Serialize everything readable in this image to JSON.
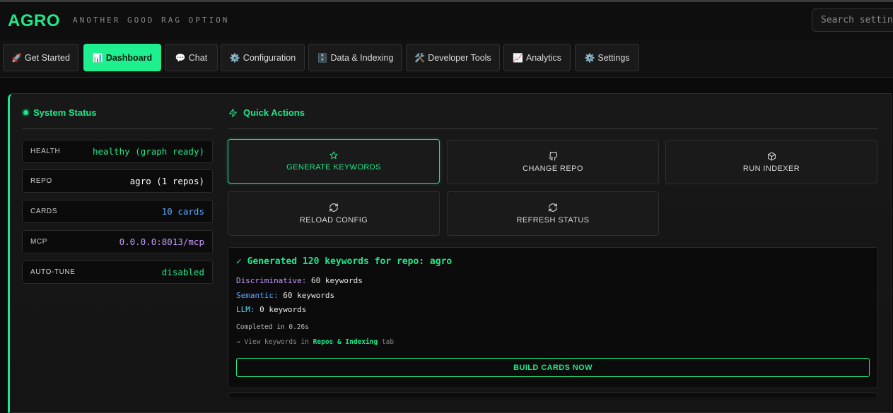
{
  "header": {
    "logo": "AGRO",
    "tagline": "ANOTHER GOOD RAG OPTION",
    "search_placeholder": "Search settings"
  },
  "tabs": [
    {
      "icon": "🚀",
      "label": "Get Started",
      "active": false
    },
    {
      "icon": "📊",
      "label": "Dashboard",
      "active": true
    },
    {
      "icon": "💬",
      "label": "Chat",
      "active": false
    },
    {
      "icon": "⚙️",
      "label": "Configuration",
      "active": false
    },
    {
      "icon": "🗄️",
      "label": "Data & Indexing",
      "active": false
    },
    {
      "icon": "🛠️",
      "label": "Developer Tools",
      "active": false
    },
    {
      "icon": "📈",
      "label": "Analytics",
      "active": false
    },
    {
      "icon": "⚙️",
      "label": "Settings",
      "active": false
    }
  ],
  "system_status": {
    "title": "System Status",
    "items": [
      {
        "key": "HEALTH",
        "value": "healthy (graph ready)",
        "color": "#1ee88a"
      },
      {
        "key": "REPO",
        "value": "agro (1 repos)",
        "color": "#ffffff"
      },
      {
        "key": "CARDS",
        "value": "10 cards",
        "color": "#5aa9ff"
      },
      {
        "key": "MCP",
        "value": "0.0.0.0:8013/mcp",
        "color": "#c59bff"
      },
      {
        "key": "AUTO-TUNE",
        "value": "disabled",
        "color": "#1ee88a"
      }
    ]
  },
  "quick_actions": {
    "title": "Quick Actions",
    "buttons": [
      {
        "label": "GENERATE KEYWORDS",
        "icon": "star-icon",
        "active": true
      },
      {
        "label": "CHANGE REPO",
        "icon": "github-icon",
        "active": false
      },
      {
        "label": "RUN INDEXER",
        "icon": "box-icon",
        "active": false
      },
      {
        "label": "RELOAD CONFIG",
        "icon": "refresh-icon",
        "active": false
      },
      {
        "label": "REFRESH STATUS",
        "icon": "refresh-icon",
        "active": false
      }
    ]
  },
  "result": {
    "title": "✓ Generated 120 keywords for repo: agro",
    "lines": [
      {
        "label": "Discriminative:",
        "value": " 60 keywords",
        "label_color": "#c59bff"
      },
      {
        "label": "Semantic:",
        "value": " 60 keywords",
        "label_color": "#5aa9ff"
      },
      {
        "label": "LLM:",
        "value": " 0 keywords",
        "label_color": "#5ad8ff"
      }
    ],
    "completed": "Completed in 0.26s",
    "view_prefix": "→ View keywords in ",
    "view_link": "Repos & Indexing",
    "view_suffix": " tab",
    "build_button": "BUILD CARDS NOW"
  }
}
